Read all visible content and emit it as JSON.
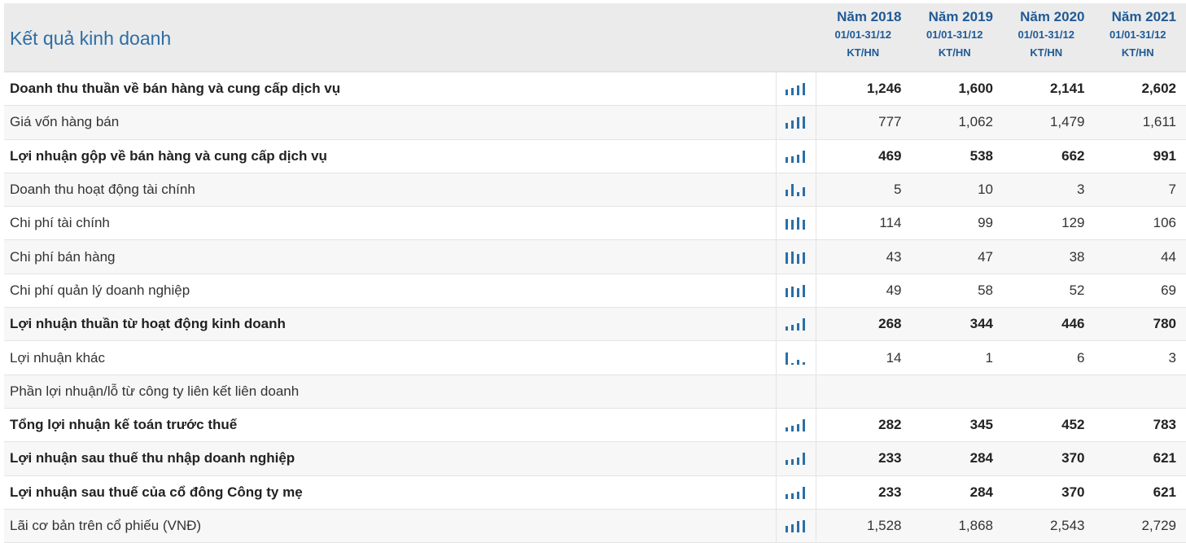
{
  "table": {
    "title": "Kết quả kinh doanh",
    "columns": [
      {
        "year": "Năm 2018",
        "period": "01/01-31/12",
        "audit": "KT/HN"
      },
      {
        "year": "Năm 2019",
        "period": "01/01-31/12",
        "audit": "KT/HN"
      },
      {
        "year": "Năm 2020",
        "period": "01/01-31/12",
        "audit": "KT/HN"
      },
      {
        "year": "Năm 2021",
        "period": "01/01-31/12",
        "audit": "KT/HN"
      }
    ],
    "rows": [
      {
        "label": "Doanh thu thuần về bán hàng và cung cấp dịch vụ",
        "bold": true,
        "chart_icon": "mini-bar-chart-icon",
        "values": [
          "1,246",
          "1,600",
          "2,141",
          "2,602"
        ]
      },
      {
        "label": "Giá vốn hàng bán",
        "bold": false,
        "chart_icon": "mini-bar-chart-icon",
        "values": [
          "777",
          "1,062",
          "1,479",
          "1,611"
        ]
      },
      {
        "label": "Lợi nhuận gộp về bán hàng và cung cấp dịch vụ",
        "bold": true,
        "chart_icon": "mini-bar-chart-icon",
        "values": [
          "469",
          "538",
          "662",
          "991"
        ]
      },
      {
        "label": "Doanh thu hoạt động tài chính",
        "bold": false,
        "chart_icon": "mini-bar-chart-icon",
        "values": [
          "5",
          "10",
          "3",
          "7"
        ]
      },
      {
        "label": "Chi phí tài chính",
        "bold": false,
        "chart_icon": "mini-bar-chart-icon",
        "values": [
          "114",
          "99",
          "129",
          "106"
        ]
      },
      {
        "label": "Chi phí bán hàng",
        "bold": false,
        "chart_icon": "mini-bar-chart-icon",
        "values": [
          "43",
          "47",
          "38",
          "44"
        ]
      },
      {
        "label": "Chi phí quản lý doanh nghiệp",
        "bold": false,
        "chart_icon": "mini-bar-chart-icon",
        "values": [
          "49",
          "58",
          "52",
          "69"
        ]
      },
      {
        "label": "Lợi nhuận thuần từ hoạt động kinh doanh",
        "bold": true,
        "chart_icon": "mini-bar-chart-icon",
        "values": [
          "268",
          "344",
          "446",
          "780"
        ]
      },
      {
        "label": "Lợi nhuận khác",
        "bold": false,
        "chart_icon": "mini-bar-chart-icon",
        "values": [
          "14",
          "1",
          "6",
          "3"
        ]
      },
      {
        "label": "Phần lợi nhuận/lỗ từ công ty liên kết liên doanh",
        "bold": false,
        "chart_icon": "",
        "values": [
          "",
          "",
          "",
          ""
        ]
      },
      {
        "label": "Tổng lợi nhuận kế toán trước thuế",
        "bold": true,
        "chart_icon": "mini-bar-chart-icon",
        "values": [
          "282",
          "345",
          "452",
          "783"
        ]
      },
      {
        "label": "Lợi nhuận sau thuế thu nhập doanh nghiệp",
        "bold": true,
        "chart_icon": "mini-bar-chart-icon",
        "values": [
          "233",
          "284",
          "370",
          "621"
        ]
      },
      {
        "label": "Lợi nhuận sau thuế của cổ đông Công ty mẹ",
        "bold": true,
        "chart_icon": "mini-bar-chart-icon",
        "values": [
          "233",
          "284",
          "370",
          "621"
        ]
      },
      {
        "label": "Lãi cơ bản trên cổ phiếu (VNĐ)",
        "bold": false,
        "chart_icon": "mini-bar-chart-icon",
        "values": [
          "1,528",
          "1,868",
          "2,543",
          "2,729"
        ]
      }
    ]
  },
  "colors": {
    "title": "#2e6da4",
    "header_bg": "#ebebeb",
    "spark_bar": "#2a6fa8"
  }
}
